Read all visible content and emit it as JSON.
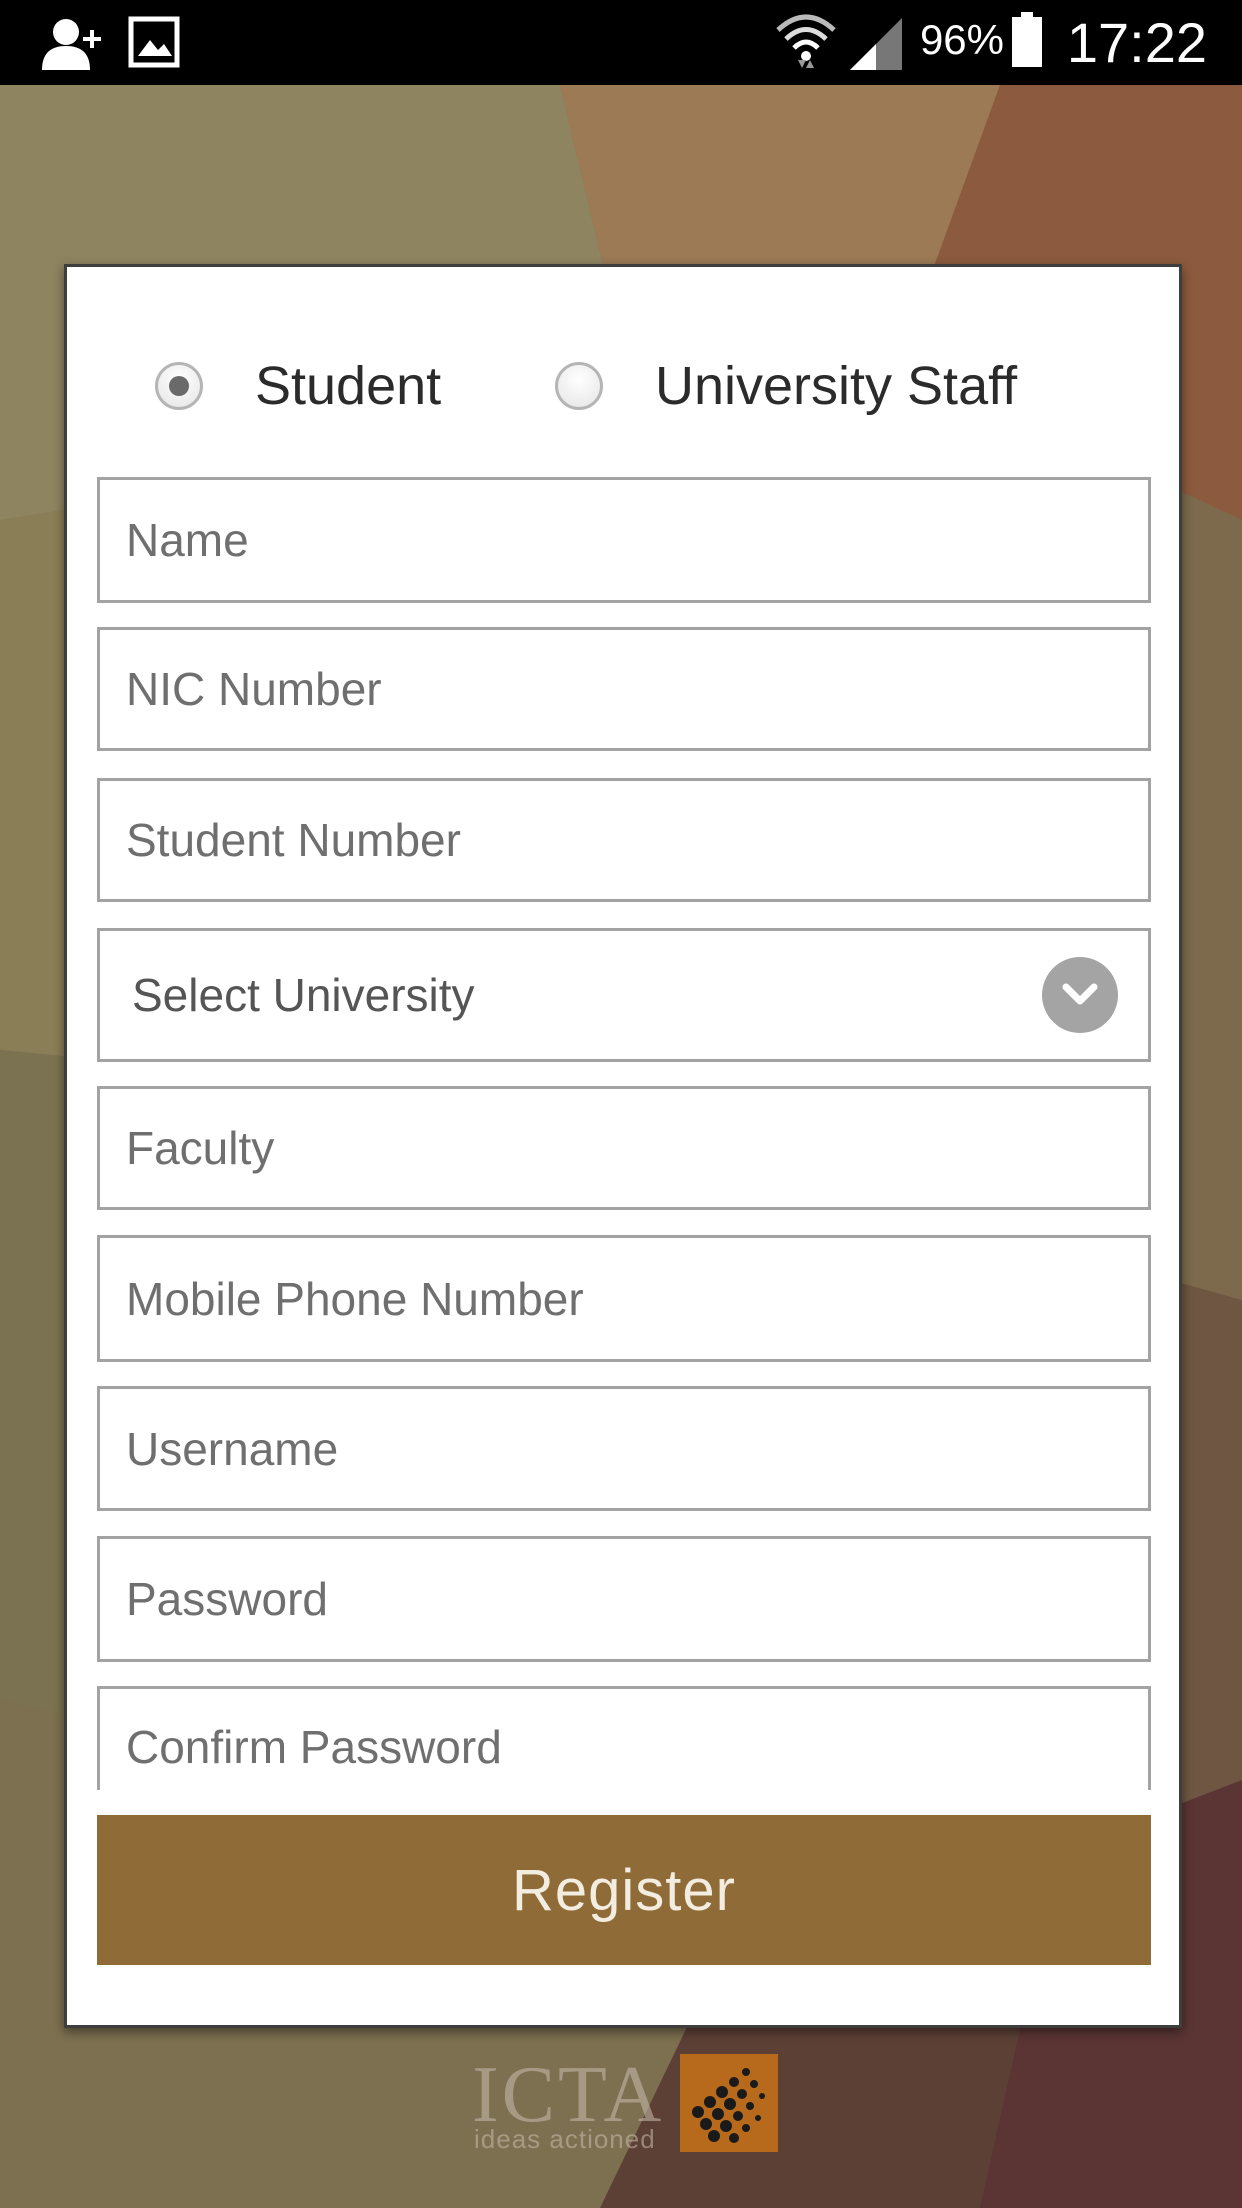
{
  "status_bar": {
    "battery_percent": "96%",
    "time": "17:22",
    "icons": [
      "add-user-icon",
      "image-icon",
      "wifi-icon",
      "signal-icon",
      "battery-icon"
    ]
  },
  "user_type": {
    "options": [
      {
        "label": "Student",
        "selected": true
      },
      {
        "label": "University Staff",
        "selected": false
      }
    ]
  },
  "form": {
    "name_placeholder": "Name",
    "nic_placeholder": "NIC Number",
    "student_number_placeholder": "Student Number",
    "university_select": "Select University",
    "faculty_placeholder": "Faculty",
    "mobile_placeholder": "Mobile Phone Number",
    "username_placeholder": "Username",
    "password_placeholder": "Password",
    "confirm_password_placeholder": "Confirm Password"
  },
  "register_label": "Register",
  "logo": {
    "name": "ICTA",
    "tagline": "ideas actioned"
  },
  "colors": {
    "accent": "#8f6c37",
    "logo_mark": "#b86a1c"
  }
}
